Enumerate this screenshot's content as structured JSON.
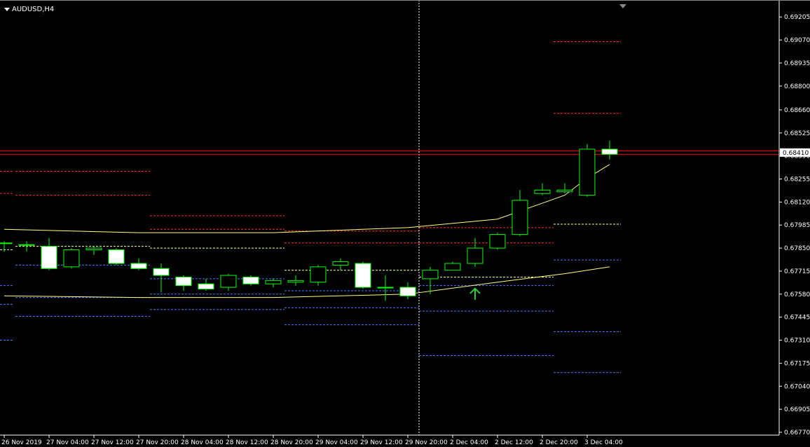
{
  "window": {
    "symbol": "AUDUSD,H4"
  },
  "current_price_label": "0.68410",
  "colors": {
    "background": "#000000",
    "axis": "#ffffff",
    "bull": "#00ff00",
    "bear_fill": "#ffffff",
    "ma": "#ffff80",
    "red_level": "#ff3030",
    "blue_level": "#4a78ff",
    "yellow_level": "#ffff80",
    "price_line": "#ff0000",
    "arrow": "#2ecc40"
  },
  "chart_data": {
    "type": "candlestick",
    "symbol": "AUDUSD",
    "timeframe": "H4",
    "y_ticks": [
      "0.69205",
      "0.69070",
      "0.68935",
      "0.68800",
      "0.68660",
      "0.68525",
      "0.68390",
      "0.68255",
      "0.68120",
      "0.67985",
      "0.67850",
      "0.67715",
      "0.67580",
      "0.67445",
      "0.67310",
      "0.67175",
      "0.67040",
      "0.66905",
      "0.66770"
    ],
    "ylim": [
      0.6677,
      0.6921
    ],
    "x_ticks": [
      {
        "label": "26 Nov 2019",
        "bar": 0
      },
      {
        "label": "27 Nov 04:00",
        "bar": 2
      },
      {
        "label": "27 Nov 12:00",
        "bar": 4
      },
      {
        "label": "27 Nov 20:00",
        "bar": 6
      },
      {
        "label": "28 Nov 04:00",
        "bar": 8
      },
      {
        "label": "28 Nov 12:00",
        "bar": 10
      },
      {
        "label": "28 Nov 20:00",
        "bar": 12
      },
      {
        "label": "29 Nov 04:00",
        "bar": 14
      },
      {
        "label": "29 Nov 12:00",
        "bar": 16
      },
      {
        "label": "29 Nov 20:00",
        "bar": 18
      },
      {
        "label": "2 Dec 04:00",
        "bar": 20
      },
      {
        "label": "2 Dec 12:00",
        "bar": 22
      },
      {
        "label": "2 Dec 20:00",
        "bar": 24
      },
      {
        "label": "3 Dec 04:00",
        "bar": 26
      }
    ],
    "candles": [
      {
        "o": 0.6788,
        "h": 0.6789,
        "l": 0.6783,
        "c": 0.6788
      },
      {
        "o": 0.6787,
        "h": 0.6789,
        "l": 0.6783,
        "c": 0.6787
      },
      {
        "o": 0.6786,
        "h": 0.6791,
        "l": 0.6772,
        "c": 0.6773
      },
      {
        "o": 0.6774,
        "h": 0.6785,
        "l": 0.6773,
        "c": 0.6784
      },
      {
        "o": 0.6784,
        "h": 0.6786,
        "l": 0.6781,
        "c": 0.6785
      },
      {
        "o": 0.6784,
        "h": 0.6785,
        "l": 0.6775,
        "c": 0.6776
      },
      {
        "o": 0.6776,
        "h": 0.6779,
        "l": 0.6772,
        "c": 0.6773
      },
      {
        "o": 0.6773,
        "h": 0.6776,
        "l": 0.6759,
        "c": 0.6769
      },
      {
        "o": 0.6768,
        "h": 0.6769,
        "l": 0.676,
        "c": 0.6763
      },
      {
        "o": 0.6764,
        "h": 0.6767,
        "l": 0.676,
        "c": 0.6761
      },
      {
        "o": 0.6762,
        "h": 0.677,
        "l": 0.676,
        "c": 0.6769
      },
      {
        "o": 0.6768,
        "h": 0.6769,
        "l": 0.6763,
        "c": 0.6764
      },
      {
        "o": 0.6764,
        "h": 0.6767,
        "l": 0.6762,
        "c": 0.6766
      },
      {
        "o": 0.6765,
        "h": 0.6769,
        "l": 0.6763,
        "c": 0.6766
      },
      {
        "o": 0.6765,
        "h": 0.6775,
        "l": 0.6763,
        "c": 0.6774
      },
      {
        "o": 0.6775,
        "h": 0.6779,
        "l": 0.6772,
        "c": 0.6777
      },
      {
        "o": 0.6776,
        "h": 0.6777,
        "l": 0.6761,
        "c": 0.6762
      },
      {
        "o": 0.6762,
        "h": 0.6769,
        "l": 0.6754,
        "c": 0.6762
      },
      {
        "o": 0.6762,
        "h": 0.6765,
        "l": 0.6755,
        "c": 0.6757
      },
      {
        "o": 0.6767,
        "h": 0.6774,
        "l": 0.6758,
        "c": 0.6772
      },
      {
        "o": 0.6772,
        "h": 0.6777,
        "l": 0.6772,
        "c": 0.6776
      },
      {
        "o": 0.6776,
        "h": 0.6791,
        "l": 0.6774,
        "c": 0.6785
      },
      {
        "o": 0.6785,
        "h": 0.6794,
        "l": 0.6784,
        "c": 0.6793
      },
      {
        "o": 0.6793,
        "h": 0.6819,
        "l": 0.6792,
        "c": 0.6813
      },
      {
        "o": 0.6817,
        "h": 0.6823,
        "l": 0.6816,
        "c": 0.6819
      },
      {
        "o": 0.6818,
        "h": 0.6823,
        "l": 0.6817,
        "c": 0.6819
      },
      {
        "o": 0.6816,
        "h": 0.6846,
        "l": 0.6815,
        "c": 0.6843
      },
      {
        "o": 0.6843,
        "h": 0.6848,
        "l": 0.6837,
        "c": 0.684
      }
    ],
    "ma_fast": [
      [
        0,
        0.6796
      ],
      [
        6,
        0.6794
      ],
      [
        12,
        0.6794
      ],
      [
        18,
        0.6797
      ],
      [
        22,
        0.6802
      ],
      [
        25,
        0.6816
      ],
      [
        26,
        0.6826
      ],
      [
        27,
        0.6834
      ]
    ],
    "ma_slow": [
      [
        0,
        0.6757
      ],
      [
        6,
        0.6756
      ],
      [
        12,
        0.6756
      ],
      [
        18,
        0.6758
      ],
      [
        22,
        0.6765
      ],
      [
        25,
        0.677
      ],
      [
        27,
        0.6774
      ]
    ],
    "pivot_levels": [
      {
        "from": -0.5,
        "to": 0.4,
        "values": {
          "r1": 0.683,
          "r2": 0.6817,
          "p": 0.6784,
          "s1": 0.6763,
          "s2": 0.6752,
          "s3": 0.6731
        }
      },
      {
        "from": 0.5,
        "to": 6.5,
        "values": {
          "r1": 0.683,
          "r2": 0.6816,
          "p": 0.6786,
          "s1": 0.6775,
          "s2": 0.6756,
          "s3": 0.6745
        }
      },
      {
        "from": 6.5,
        "to": 12.5,
        "values": {
          "r1": 0.6804,
          "r2": 0.6796,
          "p": 0.6785,
          "s1": 0.6767,
          "s2": 0.6758,
          "s3": 0.6749
        }
      },
      {
        "from": 12.5,
        "to": 18.5,
        "values": {
          "r1": 0.6795,
          "r2": 0.6788,
          "p": 0.6772,
          "s1": 0.676,
          "s2": 0.675,
          "s3": 0.674
        }
      },
      {
        "from": 18.5,
        "to": 24.5,
        "values": {
          "r1": 0.6797,
          "r2": 0.6788,
          "p": 0.6768,
          "s1": 0.6763,
          "s2": 0.6748,
          "s3": 0.6722
        }
      },
      {
        "from": 24.5,
        "to": 27.5,
        "values": {
          "r1": 0.6906,
          "r2": 0.6864,
          "p": 0.6799,
          "s1": 0.6778,
          "s2": 0.6736,
          "s3": 0.6712
        }
      }
    ],
    "price_lines": [
      0.6842,
      0.684
    ],
    "current_price": 0.6841,
    "signal_arrow": {
      "bar": 21,
      "price": 0.6758,
      "direction": "up"
    },
    "cursor_bar": 18.5
  }
}
